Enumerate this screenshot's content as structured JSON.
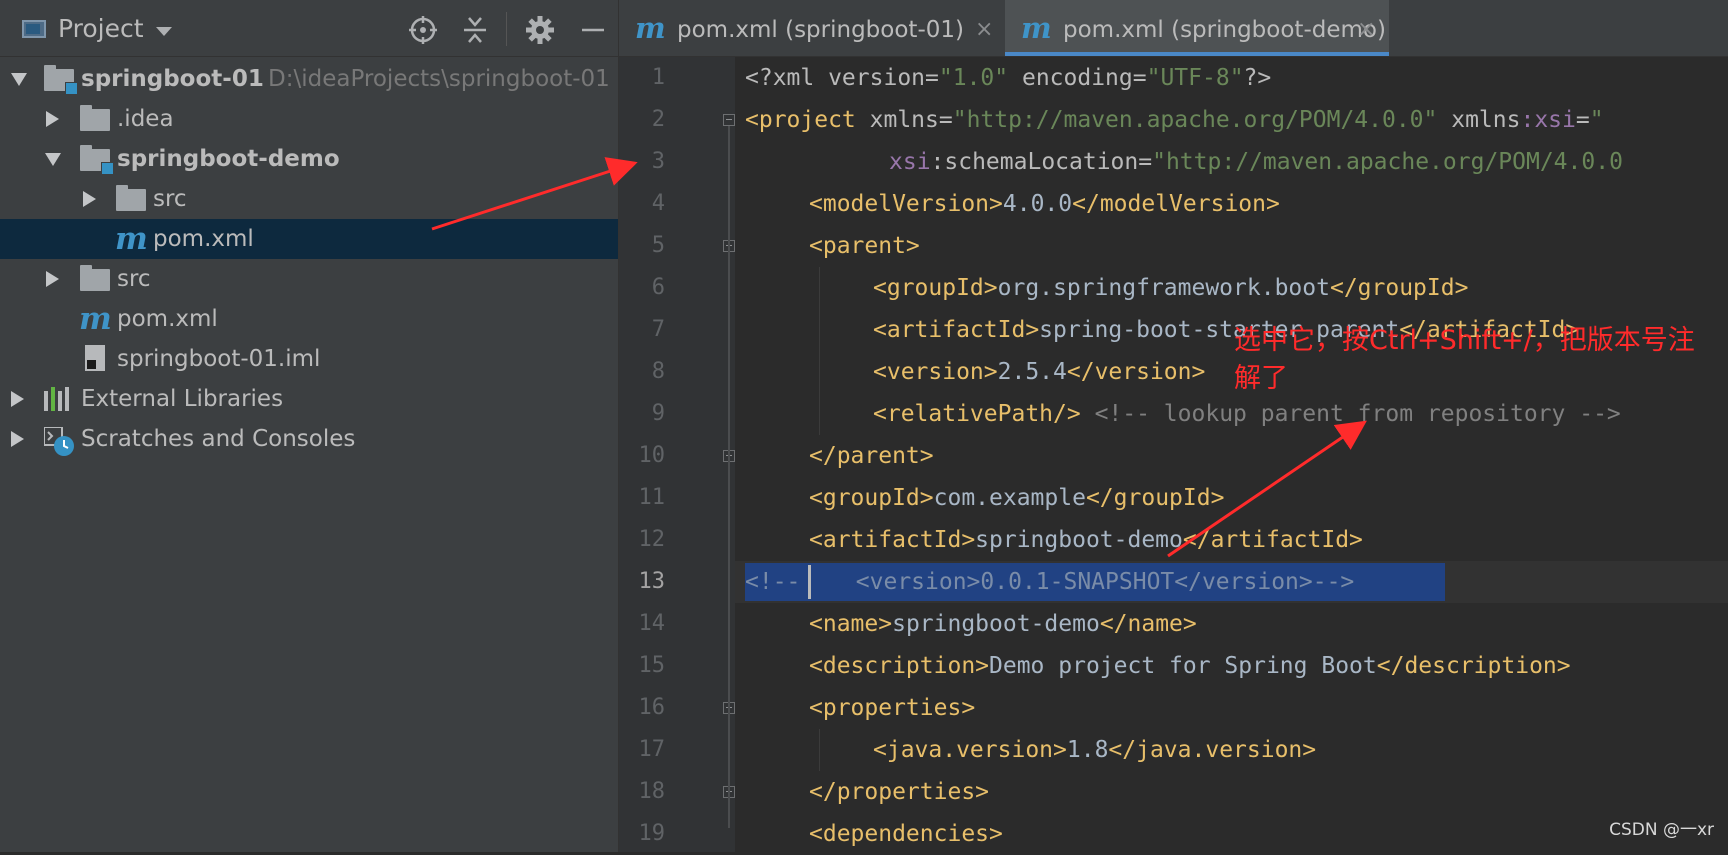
{
  "project_panel": {
    "title": "Project",
    "tree": [
      {
        "label": "springboot-01",
        "path": "D:\\ideaProjects\\springboot-01"
      },
      {
        "label": ".idea"
      },
      {
        "label": "springboot-demo"
      },
      {
        "label": "src"
      },
      {
        "label": "pom.xml"
      },
      {
        "label": "src"
      },
      {
        "label": "pom.xml"
      },
      {
        "label": "springboot-01.iml"
      },
      {
        "label": "External Libraries"
      },
      {
        "label": "Scratches and Consoles"
      }
    ]
  },
  "editor": {
    "tabs": [
      {
        "label": "pom.xml (springboot-01)",
        "close": "×"
      },
      {
        "label": "pom.xml (springboot-demo)",
        "close": "×"
      }
    ],
    "line_numbers": [
      "1",
      "2",
      "3",
      "4",
      "5",
      "6",
      "7",
      "8",
      "9",
      "10",
      "11",
      "12",
      "13",
      "14",
      "15",
      "16",
      "17",
      "18",
      "19"
    ],
    "code": {
      "l1": {
        "p1": "<?xml version=",
        "v1": "\"1.0\"",
        "p2": " encoding=",
        "v2": "\"UTF-8\"",
        "p3": "?>"
      },
      "l2": {
        "tag": "<project",
        "a1": " xmlns=",
        "v1": "\"http://maven.apache.org/POM/4.0.0\"",
        "a2": " xmlns",
        "ns": ":xsi",
        "a3": "=",
        "v2": "\""
      },
      "l3": {
        "ns": "xsi",
        "a1": ":schemaLocation=",
        "v1": "\"http://maven.apache.org/POM/4.0.0"
      },
      "l4": {
        "o": "<modelVersion>",
        "t": "4.0.0",
        "c": "</modelVersion>"
      },
      "l5": {
        "o": "<parent>"
      },
      "l6": {
        "o": "<groupId>",
        "t": "org.springframework.boot",
        "c": "</groupId>"
      },
      "l7": {
        "o": "<artifactId>",
        "t": "spring-boot-starter-parent",
        "c": "</artifactId>"
      },
      "l8": {
        "o": "<version>",
        "t": "2.5.4",
        "c": "</version>"
      },
      "l9": {
        "o": "<relativePath/>",
        "cm": " <!-- lookup parent from repository -->"
      },
      "l10": {
        "o": "</parent>"
      },
      "l11": {
        "o": "<groupId>",
        "t": "com.example",
        "c": "</groupId>"
      },
      "l12": {
        "o": "<artifactId>",
        "t": "springboot-demo",
        "c": "</artifactId>"
      },
      "l13": {
        "pre": "<!--",
        "rest": "    <version>0.0.1-SNAPSHOT</version>-->"
      },
      "l14": {
        "o": "<name>",
        "t": "springboot-demo",
        "c": "</name>"
      },
      "l15": {
        "o": "<description>",
        "t": "Demo project for Spring Boot",
        "c": "</description>"
      },
      "l16": {
        "o": "<properties>"
      },
      "l17": {
        "o": "<java.version>",
        "t": "1.8",
        "c": "</java.version>"
      },
      "l18": {
        "o": "</properties>"
      },
      "l19": {
        "o": "<dependencies>"
      }
    }
  },
  "annotation": "选中它，按Ctrl+Shift+/，把版本号注解了",
  "watermark": "CSDN @一xr",
  "colors": {
    "tag": "#e8bf6a",
    "string": "#6a8759",
    "comment": "#808080",
    "selection": "#214283",
    "annotation": "#ff2b2b"
  }
}
